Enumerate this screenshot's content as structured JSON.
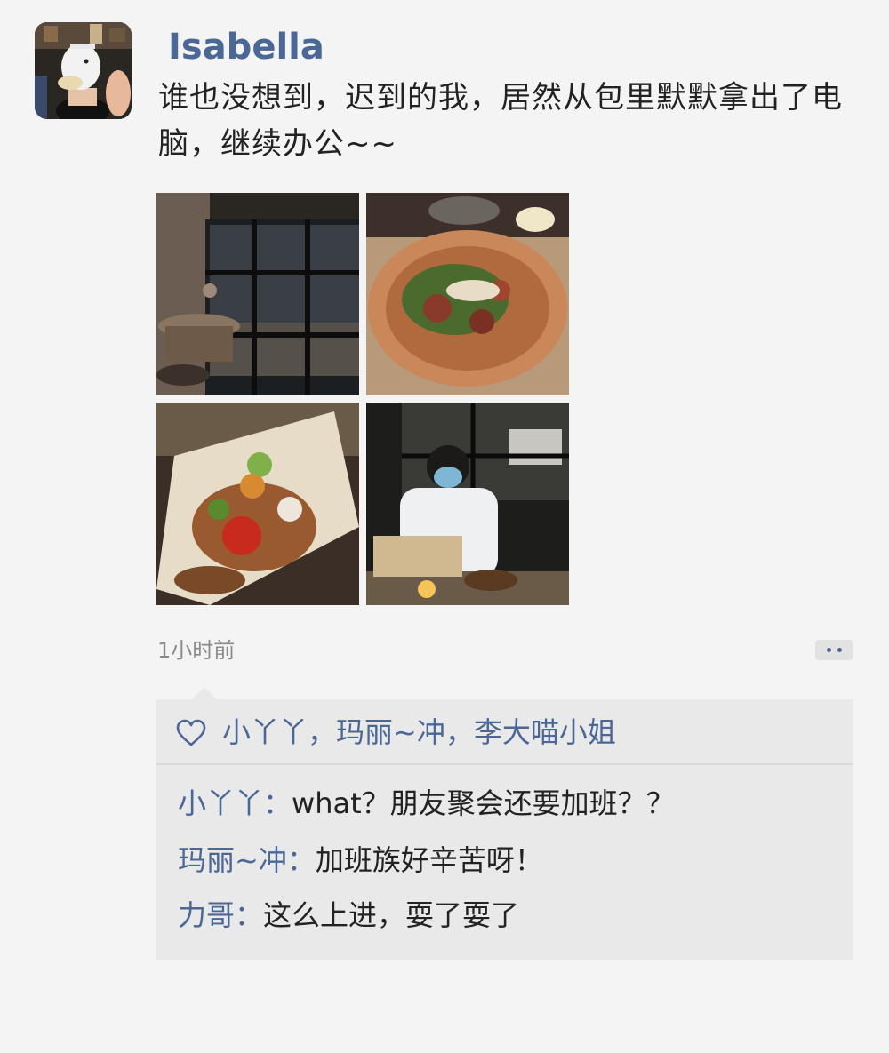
{
  "post": {
    "author": "Isabella",
    "text": "谁也没想到，迟到的我，居然从包里默默拿出了电脑，继续办公~~",
    "timestamp": "1小时前",
    "photos": [
      {
        "description": "restaurant-window-night"
      },
      {
        "description": "salad-bowl"
      },
      {
        "description": "food-platter"
      },
      {
        "description": "person-working-laptop"
      }
    ]
  },
  "likes": {
    "names": "小丫丫，玛丽~冲，李大喵小姐"
  },
  "comments": [
    {
      "author": "小丫丫：",
      "text": "what？朋友聚会还要加班？？"
    },
    {
      "author": "玛丽~冲：",
      "text": "加班族好辛苦呀！"
    },
    {
      "author": "力哥：",
      "text": "这么上进，耍了耍了"
    }
  ],
  "colors": {
    "accent": "#4a6795",
    "background": "#f4f4f4",
    "panel": "#e9e9e9"
  },
  "icons": {
    "like": "heart-outline-icon",
    "more": "more-dots-icon"
  }
}
